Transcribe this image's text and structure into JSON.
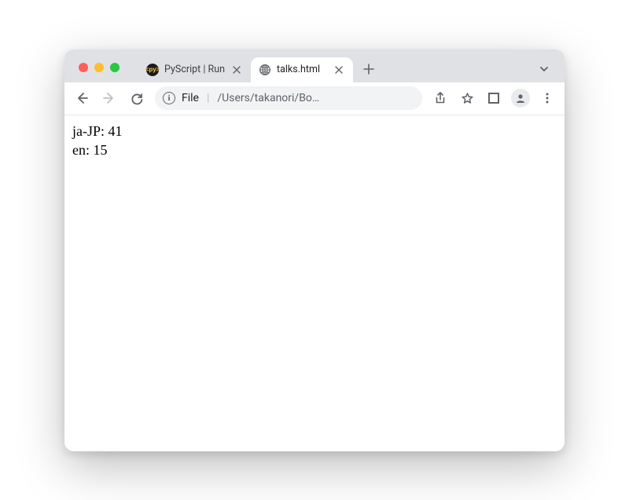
{
  "window": {
    "tabs": [
      {
        "title": "PyScript | Run",
        "favicon": "py",
        "active": false
      },
      {
        "title": "talks.html",
        "favicon": "globe",
        "active": true
      }
    ]
  },
  "toolbar": {
    "url_prefix": "File",
    "url_path": "/Users/takanori/Bo…"
  },
  "page": {
    "lines": [
      {
        "label": "ja-JP",
        "value": "41"
      },
      {
        "label": "en",
        "value": "15"
      }
    ]
  }
}
